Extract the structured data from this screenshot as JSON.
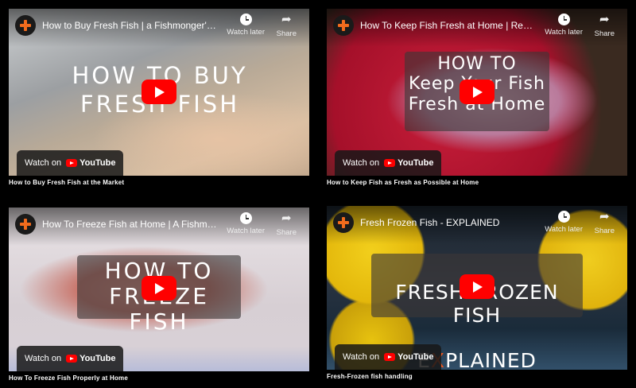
{
  "colors": {
    "channel_accent": "#f26b1d",
    "youtube_red": "#ff0000",
    "x_accent": "#ef5a24"
  },
  "common": {
    "watch_later": "Watch later",
    "share": "Share",
    "watch_on": "Watch on",
    "youtube": "YouTube"
  },
  "videos": [
    {
      "title": "How to Buy Fresh Fish | a Fishmonger's ...",
      "overlay": "HOW TO BUY\nFRESH FISH",
      "caption": "How to Buy Fresh Fish at the Market"
    },
    {
      "title": "How To Keep Fish Fresh at Home | Redu...",
      "overlay": "HOW TO\nKeep Your Fish\nFresh at Home",
      "caption": "How to Keep Fish as Fresh as Possible at Home"
    },
    {
      "title": "How To Freeze Fish at Home | A Fishmo...",
      "overlay": "HOW TO\nFREEZE FISH",
      "caption": "How To Freeze Fish Properly at Home"
    },
    {
      "title": "Fresh Frozen Fish - EXPLAINED",
      "overlay_line1": "FRESH FROZEN FISH",
      "overlay_x": "X",
      "overlay_rest": "PLAINED",
      "overlay_lead": "E",
      "caption": "Fresh-Frozen fish handling"
    }
  ]
}
